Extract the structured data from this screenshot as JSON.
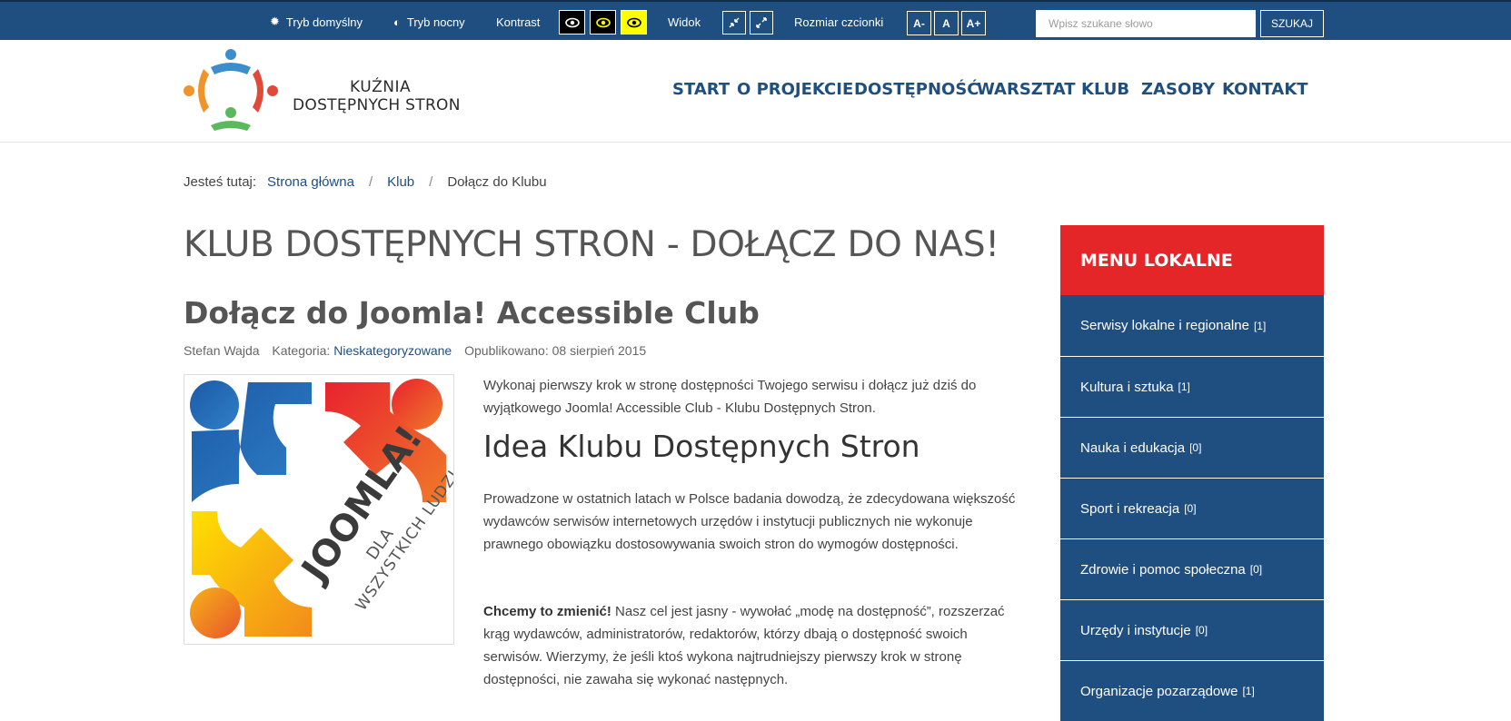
{
  "topbar": {
    "mode_default": "Tryb domyślny",
    "mode_night": "Tryb nocny",
    "contrast": "Kontrast",
    "view": "Widok",
    "font_size": "Rozmiar czcionki",
    "font_decrease": "A-",
    "font_normal": "A",
    "font_increase": "A+",
    "search_placeholder": "Wpisz szukane słowo",
    "search_button": "SZUKAJ",
    "colors": {
      "bar": "#1f4e80",
      "contrast_bg": "#000000",
      "contrast_yellow": "#ffff00"
    }
  },
  "logo": {
    "line1": "KUŹNIA",
    "line2": "DOSTĘPNYCH STRON"
  },
  "nav": [
    "START",
    "O PROJEKCIE",
    "DOSTĘPNOŚĆ",
    "WARSZTAT",
    "KLUB",
    "ZASOBY",
    "KONTAKT"
  ],
  "breadcrumb": {
    "label": "Jesteś tutaj:",
    "items": [
      "Strona główna",
      "Klub",
      "Dołącz do Klubu"
    ]
  },
  "page_title": "KLUB DOSTĘPNYCH STRON - DOŁĄCZ DO NAS!",
  "article": {
    "title": "Dołącz do Joomla! Accessible Club",
    "author": "Stefan Wajda",
    "category_label": "Kategoria:",
    "category": "Nieskategoryzowane",
    "published": "Opublikowano: 08 sierpień 2015",
    "image_text": {
      "joomla": "JOOMLA!",
      "dla": "DLA",
      "wszystkich": "WSZYSTKICH LUDZI"
    },
    "intro": "Wykonaj pierwszy krok w stronę dostępności Twojego serwisu i dołącz już dziś do wyjątkowego Joomla! Accessible Club - Klubu Dostępnych Stron.",
    "idea_title": "Idea Klubu Dostępnych Stron",
    "p1": "Prowadzone w ostatnich latach w Polsce badania dowodzą, że zdecydowana większość wydawców serwisów internetowych urzędów i instytucji publicznych nie wykonuje prawnego obowiązku dostosowywania swoich stron do wymogów dostępności.",
    "p2_strong": "Chcemy to zmienić!",
    "p2": " Nasz cel jest jasny - wywołać „modę na dostępność”, rozszerzać krąg wydawców, administratorów, redaktorów, którzy dbają o dostępność swoich serwisów. Wierzymy, że jeśli ktoś wykona najtrudniejszy pierwszy krok w stronę dostępności, nie zawaha się wykonać następnych."
  },
  "sidebar": {
    "title": "MENU LOKALNE",
    "items": [
      {
        "label": "Serwisy lokalne i regionalne",
        "count": "[1]"
      },
      {
        "label": "Kultura i sztuka",
        "count": "[1]"
      },
      {
        "label": "Nauka i edukacja",
        "count": "[0]"
      },
      {
        "label": "Sport i rekreacja",
        "count": "[0]"
      },
      {
        "label": "Zdrowie i pomoc społeczna",
        "count": "[0]"
      },
      {
        "label": "Urzędy i instytucje",
        "count": "[0]"
      },
      {
        "label": "Organizacje pozarządowe",
        "count": "[1]"
      }
    ],
    "colors": {
      "header": "#e52629",
      "item": "#1f4e80"
    }
  }
}
